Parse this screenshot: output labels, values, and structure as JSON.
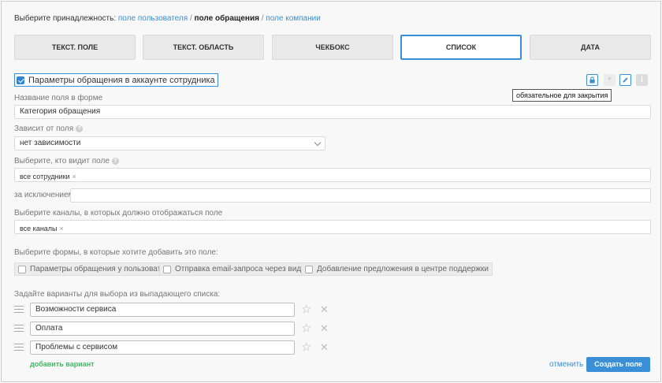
{
  "breadcrumb": {
    "prefix": "Выберите принадлежность:",
    "user_field": "поле пользователя",
    "sep1": "/",
    "ticket_field": "поле обращения",
    "sep2": "/",
    "company_field": "поле компании"
  },
  "field_types": [
    {
      "label": "ТЕКСТ. ПОЛЕ",
      "active": false
    },
    {
      "label": "ТЕКСТ. ОБЛАСТЬ",
      "active": false
    },
    {
      "label": "ЧЕКБОКС",
      "active": false
    },
    {
      "label": "СПИСОК",
      "active": true
    },
    {
      "label": "ДАТА",
      "active": false
    }
  ],
  "agent_params": {
    "label": "Параметры обращения в аккаунте сотрудника",
    "checked": true
  },
  "toolbar": {
    "tooltip": "обязательное для закрытия",
    "asterisk": "*",
    "info": "i",
    "icons": [
      "lock-icon",
      "asterisk-icon",
      "pencil-icon",
      "info-icon"
    ]
  },
  "field_name": {
    "label": "Название поля в форме",
    "value": "Категория обращения"
  },
  "depends_on": {
    "label": "Зависит от поля",
    "help": "?",
    "value": "нет зависимости"
  },
  "visible_to": {
    "label": "Выберите, кто видит поле",
    "help": "?",
    "tag": "все сотрудники",
    "remove": "×"
  },
  "except": {
    "label": "за исключением:",
    "value": ""
  },
  "channels": {
    "label": "Выберите каналы, в которых должно отображаться поле",
    "tag": "все каналы",
    "remove": "×"
  },
  "forms": {
    "label": "Выберите формы, в которые хотите добавить это поле:",
    "items": [
      {
        "label": "Параметры обращения у пользователя",
        "checked": false
      },
      {
        "label": "Отправка email-запроса через виджет",
        "checked": false
      },
      {
        "label": "Добавление предложения в центре поддержки",
        "checked": false
      }
    ]
  },
  "options": {
    "label": "Задайте варианты для выбора из выпадающего списка:",
    "items": [
      {
        "value": "Возможности сервиса"
      },
      {
        "value": "Оплата"
      },
      {
        "value": "Проблемы с сервисом"
      }
    ],
    "star": "☆",
    "remove": "✕"
  },
  "actions": {
    "add_variant": "добавить вариант",
    "cancel": "отменить",
    "create": "Создать поле"
  },
  "colors": {
    "accent": "#3a8fd6",
    "green": "#45b565"
  }
}
